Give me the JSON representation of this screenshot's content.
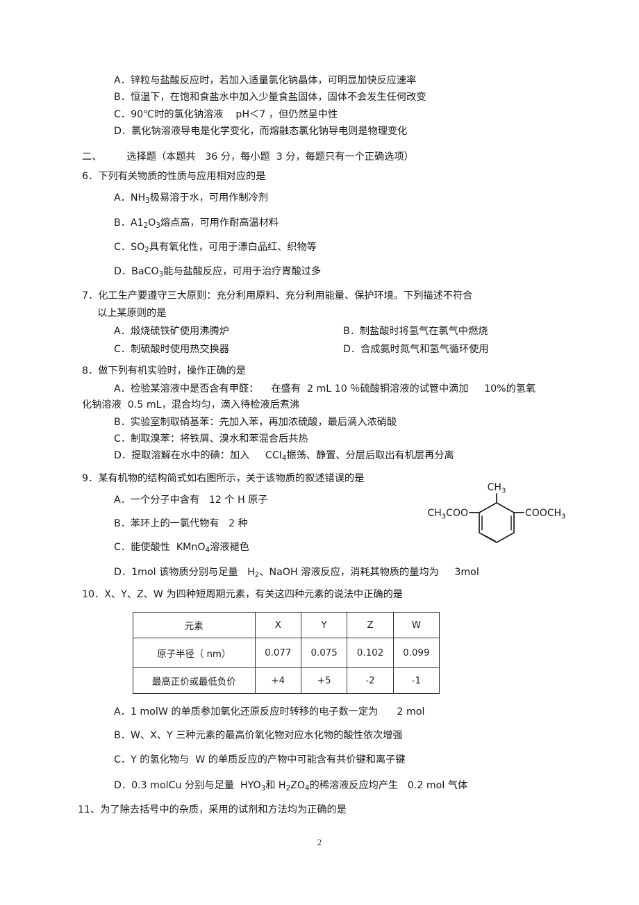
{
  "page": {
    "page_number": "2"
  },
  "q5_options": {
    "a": "A．锌粒与盐酸反应时，若加入适量氯化钠晶体，可明显加快反应速率",
    "b": "B．恒温下，在饱和食盐水中加入少量食盐固体，固体不会发生任何改变",
    "c": "C．90℃时的氯化钠溶液    pH＜7 ，但仍然呈中性",
    "d": "D．氯化钠溶液导电是化学变化，而熔融态氯化钠导电则是物理变化"
  },
  "section": {
    "number": "二、",
    "title": "选择题（本题共   36 分，每小题  3 分，每题只有一个正确选项）"
  },
  "q6": {
    "stem": "6．下列有关物质的性质与应用相对应的是",
    "options": {
      "a_pre": "A．NH",
      "a_sub": "3",
      "a_post": "极易溶于水，可用作制冷剂",
      "b_pre": "B．A1",
      "b_sub1": "2",
      "b_mid": "O",
      "b_sub2": "3",
      "b_post": "熔点高，可用作耐高温材料",
      "c_pre": "C．SO",
      "c_sub": "2",
      "c_post": "具有氧化性，可用于漂白品红、织物等",
      "d_pre": "D．BaCO",
      "d_sub": "3",
      "d_post": "能与盐酸反应，可用于治疗胃酸过多"
    }
  },
  "q7": {
    "stem_line1": "7．化工生产要遵守三大原则：充分利用原料、充分利用能量、保护环境。下列描述不符合",
    "stem_line2": "以上某原则的是",
    "options": {
      "a": "A．煅烧硫铁矿使用沸腾炉",
      "b": "B．制盐酸时将氢气在氯气中燃烧",
      "c": "C．制硫酸时使用热交换器",
      "d": "D．合成氨时氮气和氢气循环使用"
    }
  },
  "q8": {
    "stem": "8．做下列有机实验时，操作正确的是",
    "options": {
      "a_line1": "A．检验某溶液中是否含有甲醛：    在盛有  2 mL 10 ％硫酸铜溶液的试管中滴加     10%的氢氧",
      "a_line2": "化钠溶液  0.5 mL，混合均匀，滴入待检液后煮沸",
      "b": "B．实验室制取硝基苯：先加入苯，再加浓硫酸，最后滴入浓硝酸",
      "c": "C．制取溴苯：将铁屑、溴水和苯混合后共热",
      "d_pre": "D．提取溶解在水中的碘：加入     CCI",
      "d_sub": "4",
      "d_post": "振荡、静置、分层后取出有机层再分离"
    }
  },
  "q9": {
    "stem": "9．某有机物的结构简式如右图所示，关于该物质的叙述错误的是",
    "options": {
      "a": "A．一个分子中含有   12 个 H 原子",
      "b": "B．苯环上的一氯代物有   2 种",
      "c_pre": "C．能使酸性  KMnO",
      "c_sub": "4",
      "c_post": "溶液褪色",
      "d_pre": "D．1mol 该物质分别与足量   H",
      "d_sub": "2",
      "d_post": "、NaOH 溶液反应，消耗其物质的量均为     3mol"
    },
    "structure": {
      "top_label_pre": "CH",
      "top_label_sub": "3",
      "left_label_pre": "CH",
      "left_label_sub": "3",
      "left_label_post": "COO",
      "right_label_pre": "COOCH",
      "right_label_sub": "3"
    }
  },
  "q10": {
    "stem": "10．X、Y、Z、W 为四种短周期元素，有关这四种元素的说法中正确的是",
    "table": {
      "headers": [
        "元素",
        "X",
        "Y",
        "Z",
        "W"
      ],
      "rows": [
        {
          "label": "原子半径（  nm）",
          "values": [
            "0.077",
            "0.075",
            "0.102",
            "0.099"
          ]
        },
        {
          "label": "最高正价或最低负价",
          "values": [
            "+4",
            "+5",
            "-2",
            "-1"
          ]
        }
      ]
    },
    "options": {
      "a": "A．1 molW 的单质参加氧化还原反应时转移的电子数一定为      2 mol",
      "b": "B．W、X、Y 三种元素的最高价氧化物对应水化物的酸性依次增强",
      "c": "C．Y 的氢化物与  W 的单质反应的产物中可能含有共价键和离子键",
      "d_pre": "D．0.3 molCu 分别与足量  HYO",
      "d_sub1": "3",
      "d_mid": "和 H",
      "d_sub2": "2",
      "d_mid2": "ZO",
      "d_sub3": "4",
      "d_post": "的稀溶液反应均产生   0.2 mol 气体"
    }
  },
  "q11": {
    "stem": "11、为了除去括号中的杂质，采用的试剂和方法均为正确的是"
  }
}
